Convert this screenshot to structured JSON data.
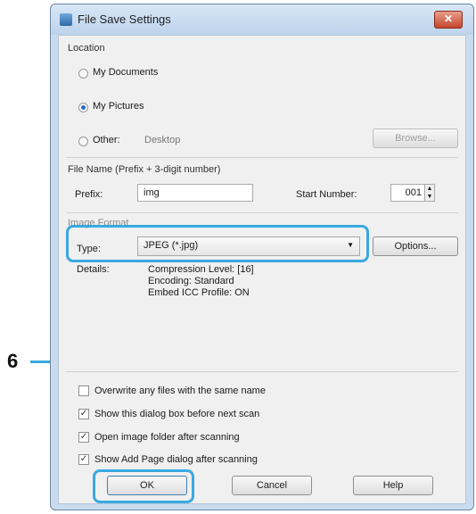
{
  "window": {
    "title": "File Save Settings",
    "close_glyph": "✕"
  },
  "location": {
    "section_label": "Location",
    "my_documents": "My Documents",
    "my_pictures": "My Pictures",
    "other": "Other:",
    "other_path": "Desktop",
    "browse_label": "Browse..."
  },
  "file_name": {
    "section_label": "File Name (Prefix + 3-digit number)",
    "prefix_label": "Prefix:",
    "prefix_value": "img",
    "start_number_label": "Start Number:",
    "start_number_value": "001"
  },
  "image_format": {
    "section_label": "Image Format",
    "type_label": "Type:",
    "type_value": "JPEG (*.jpg)",
    "options_label": "Options...",
    "details_label": "Details:",
    "details_lines": [
      "Compression Level: [16]",
      "Encoding: Standard",
      "Embed ICC Profile: ON"
    ]
  },
  "checkboxes": [
    {
      "label": "Overwrite any files with the same name",
      "checked": false
    },
    {
      "label": "Show this dialog box before next scan",
      "checked": true
    },
    {
      "label": "Open image folder after scanning",
      "checked": true
    },
    {
      "label": "Show Add Page dialog after scanning",
      "checked": true
    }
  ],
  "buttons": {
    "ok": "OK",
    "cancel": "Cancel",
    "help": "Help"
  },
  "callout": {
    "number": "6"
  },
  "colors": {
    "highlight": "#3aa8e0"
  }
}
